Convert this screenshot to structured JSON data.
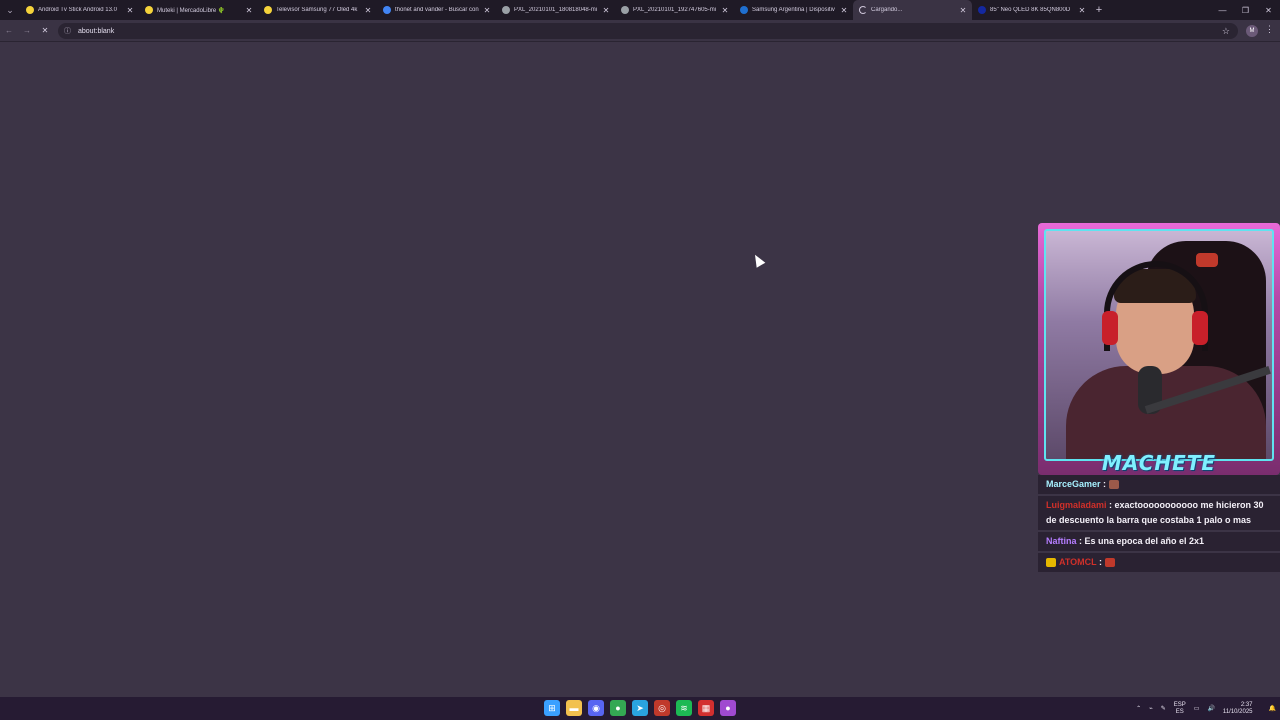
{
  "browser": {
    "tabs": [
      {
        "title": "Android Tv Stick Android 13.0 ",
        "favicon_color": "#f5d33b",
        "active": false
      },
      {
        "title": "Muteki | MercadoLibre 🌵",
        "favicon_color": "#f5d33b",
        "active": false
      },
      {
        "title": "Televisor Samsung 77 Oled 4k ",
        "favicon_color": "#f5d33b",
        "active": false
      },
      {
        "title": "thonet and vander - Buscar con",
        "favicon_color": "#4285f4",
        "active": false
      },
      {
        "title": "PXL_20210101_180818048-mi",
        "favicon_color": "#9aa0a6",
        "active": false
      },
      {
        "title": "PXL_20210101_192747605-mi",
        "favicon_color": "#9aa0a6",
        "active": false
      },
      {
        "title": "Samsung Argentina | Dispositiv",
        "favicon_color": "#1f6fd0",
        "active": false
      },
      {
        "title": "Cargando...",
        "favicon_color": "#9aa0a6",
        "active": true
      },
      {
        "title": "85\" Neo QLED 8K 85QN800D",
        "favicon_color": "#1428a0",
        "active": false
      }
    ],
    "new_tab_label": "+",
    "address": "about:blank",
    "window_controls": {
      "minimize": "—",
      "restore": "❐",
      "close": "✕"
    }
  },
  "stream_overlay": {
    "streamer_name": "MACHETE",
    "chat": [
      {
        "user": "MarceGamer",
        "user_color": "#a7f0ff",
        "text": " : ",
        "emote_color": "#9b5a4a"
      },
      {
        "user": "Luigmaladami",
        "user_color": "#d0302a",
        "text": " : exactooooooooooo me hicieron 30 de descuento la barra que costaba 1 palo o mas",
        "emote_color": ""
      },
      {
        "user": "Naftina",
        "user_color": "#b57dff",
        "text": " : Es una epoca del año el 2x1",
        "emote_color": ""
      },
      {
        "user": "ATOMCL",
        "user_color": "#d0302a",
        "text": " : ",
        "emote_color": "#c0392b",
        "badge_color": "#e6b800"
      }
    ]
  },
  "taskbar": {
    "apps": [
      {
        "name": "windows-start-icon",
        "color": "#3aa0ff",
        "glyph": "⊞"
      },
      {
        "name": "file-explorer-icon",
        "color": "#f2c14e",
        "glyph": "▬"
      },
      {
        "name": "discord-icon",
        "color": "#5865f2",
        "glyph": "◉"
      },
      {
        "name": "chrome-icon",
        "color": "#34a853",
        "glyph": "●"
      },
      {
        "name": "telegram-icon",
        "color": "#2aa3e0",
        "glyph": "➤"
      },
      {
        "name": "steam-icon",
        "color": "#c0392b",
        "glyph": "◎"
      },
      {
        "name": "spotify-icon",
        "color": "#1db954",
        "glyph": "≋"
      },
      {
        "name": "calendar-app-icon",
        "color": "#d32f2f",
        "glyph": "▦"
      },
      {
        "name": "chrome-active-icon",
        "color": "#a04ad0",
        "glyph": "●"
      }
    ],
    "language_top": "ESP",
    "language_bottom": "ES",
    "time": "2:37",
    "date": "11/10/2025"
  }
}
